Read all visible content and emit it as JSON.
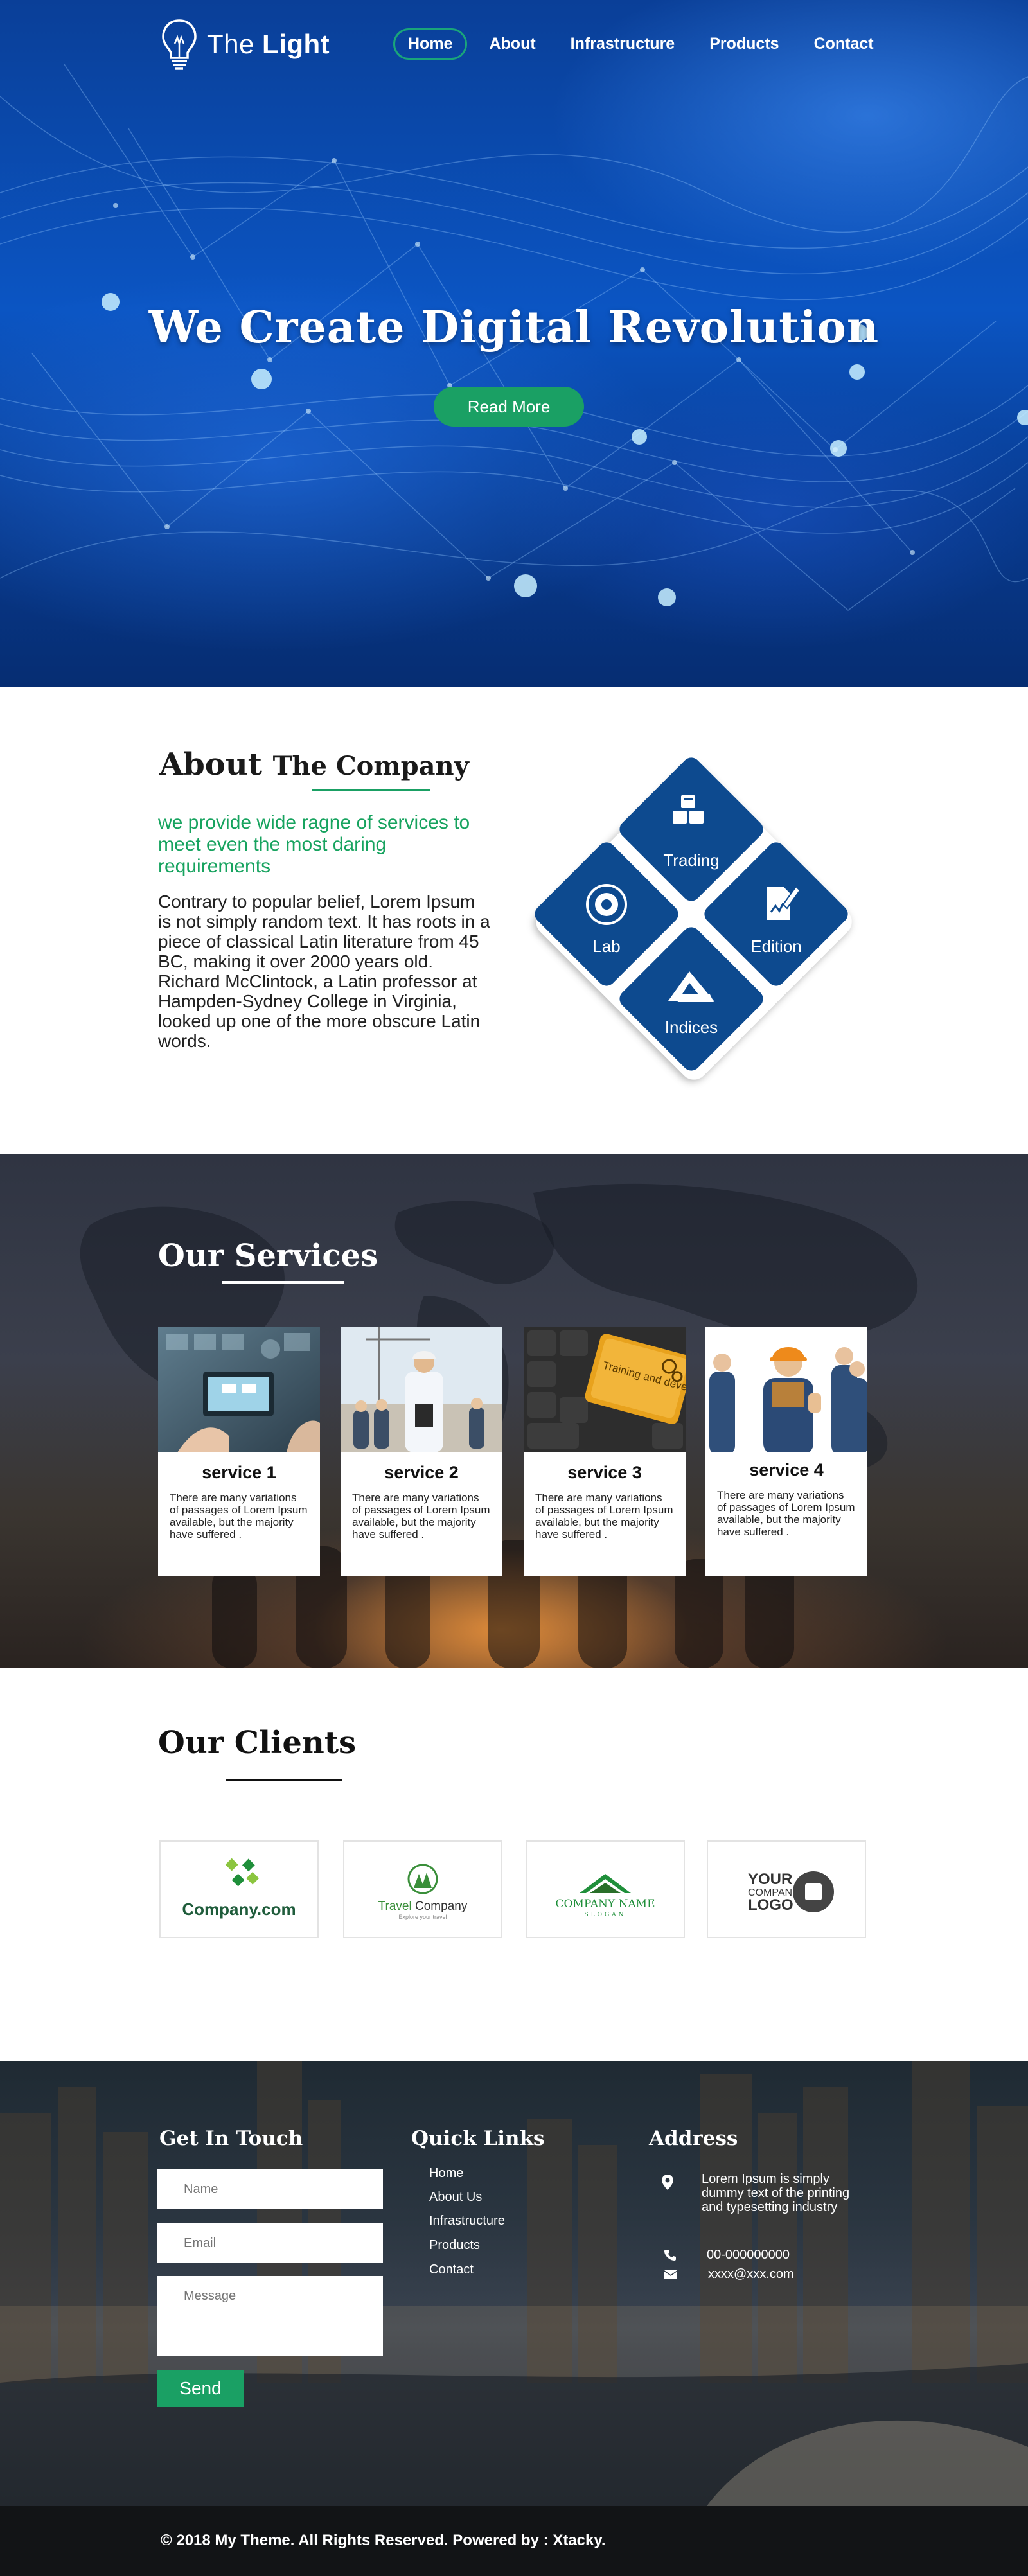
{
  "brand": {
    "name_light": "The",
    "name_bold": "Light"
  },
  "nav": {
    "items": [
      "Home",
      "About",
      "Infrastructure",
      "Products",
      "Contact"
    ],
    "active": "Home"
  },
  "hero": {
    "title": "We Create Digital Revolution",
    "button": "Read More"
  },
  "about": {
    "title_bold": "About",
    "title_rest": "The Company",
    "lead": "we provide wide ragne of services to meet even the most daring requirements",
    "body": "Contrary to popular belief, Lorem Ipsum is not simply random text. It has roots in a piece of classical Latin literature from 45 BC, making it over 2000 years old. Richard McClintock, a Latin professor at Hampden-Sydney College in Virginia, looked up one of the more obscure Latin words.",
    "diamond": [
      {
        "label": "Trading",
        "icon": "boxes-icon"
      },
      {
        "label": "Lab",
        "icon": "lab-seal-icon"
      },
      {
        "label": "Edition",
        "icon": "edit-document-icon"
      },
      {
        "label": "Indices",
        "icon": "indices-chevron-icon"
      }
    ]
  },
  "services": {
    "title_light": "Our",
    "title_bold": "Services",
    "cards": [
      {
        "title": "service 1",
        "text": "There are many variations of passages of Lorem Ipsum available, but the majority have suffered ."
      },
      {
        "title": "service 2",
        "text": "There are many variations of passages of Lorem Ipsum available, but the majority have suffered ."
      },
      {
        "title": "service 3",
        "text": "There are many variations of passages of Lorem Ipsum available, but the majority have suffered ."
      },
      {
        "title": "service 4",
        "text": "There are many variations of passages of Lorem Ipsum available, but the majority have suffered ."
      }
    ],
    "keyboard_key_text": "Training and development"
  },
  "clients": {
    "title_light": "Our",
    "title_bold": "Clients",
    "logos": [
      {
        "text": "Company.com"
      },
      {
        "text_a": "Travel",
        "text_b": "Company",
        "tagline": "Explore your travel"
      },
      {
        "text": "COMPANY NAME",
        "tagline": "SLOGAN"
      },
      {
        "line1": "YOUR",
        "line2": "COMPANY",
        "line3": "LOGO"
      }
    ]
  },
  "footer": {
    "get_in_touch": "Get In Touch",
    "name_placeholder": "Name",
    "email_placeholder": "Email",
    "message_placeholder": "Message",
    "send": "Send",
    "quick_links_title": "Quick Links",
    "quick_links": [
      "Home",
      "About Us",
      "Infrastructure",
      "Products",
      "Contact"
    ],
    "address_title": "Address",
    "address_text": "Lorem Ipsum is simply dummy text of the printing and typesetting industry",
    "phone": "00-000000000",
    "email": "xxxx@xxx.com"
  },
  "copyright": "© 2018 My Theme. All Rights Reserved. Powered by : Xtacky.",
  "colors": {
    "accent_green": "#1aa064",
    "diamond_blue": "#0d4a8f",
    "hero_blue": "#0b55c3"
  }
}
